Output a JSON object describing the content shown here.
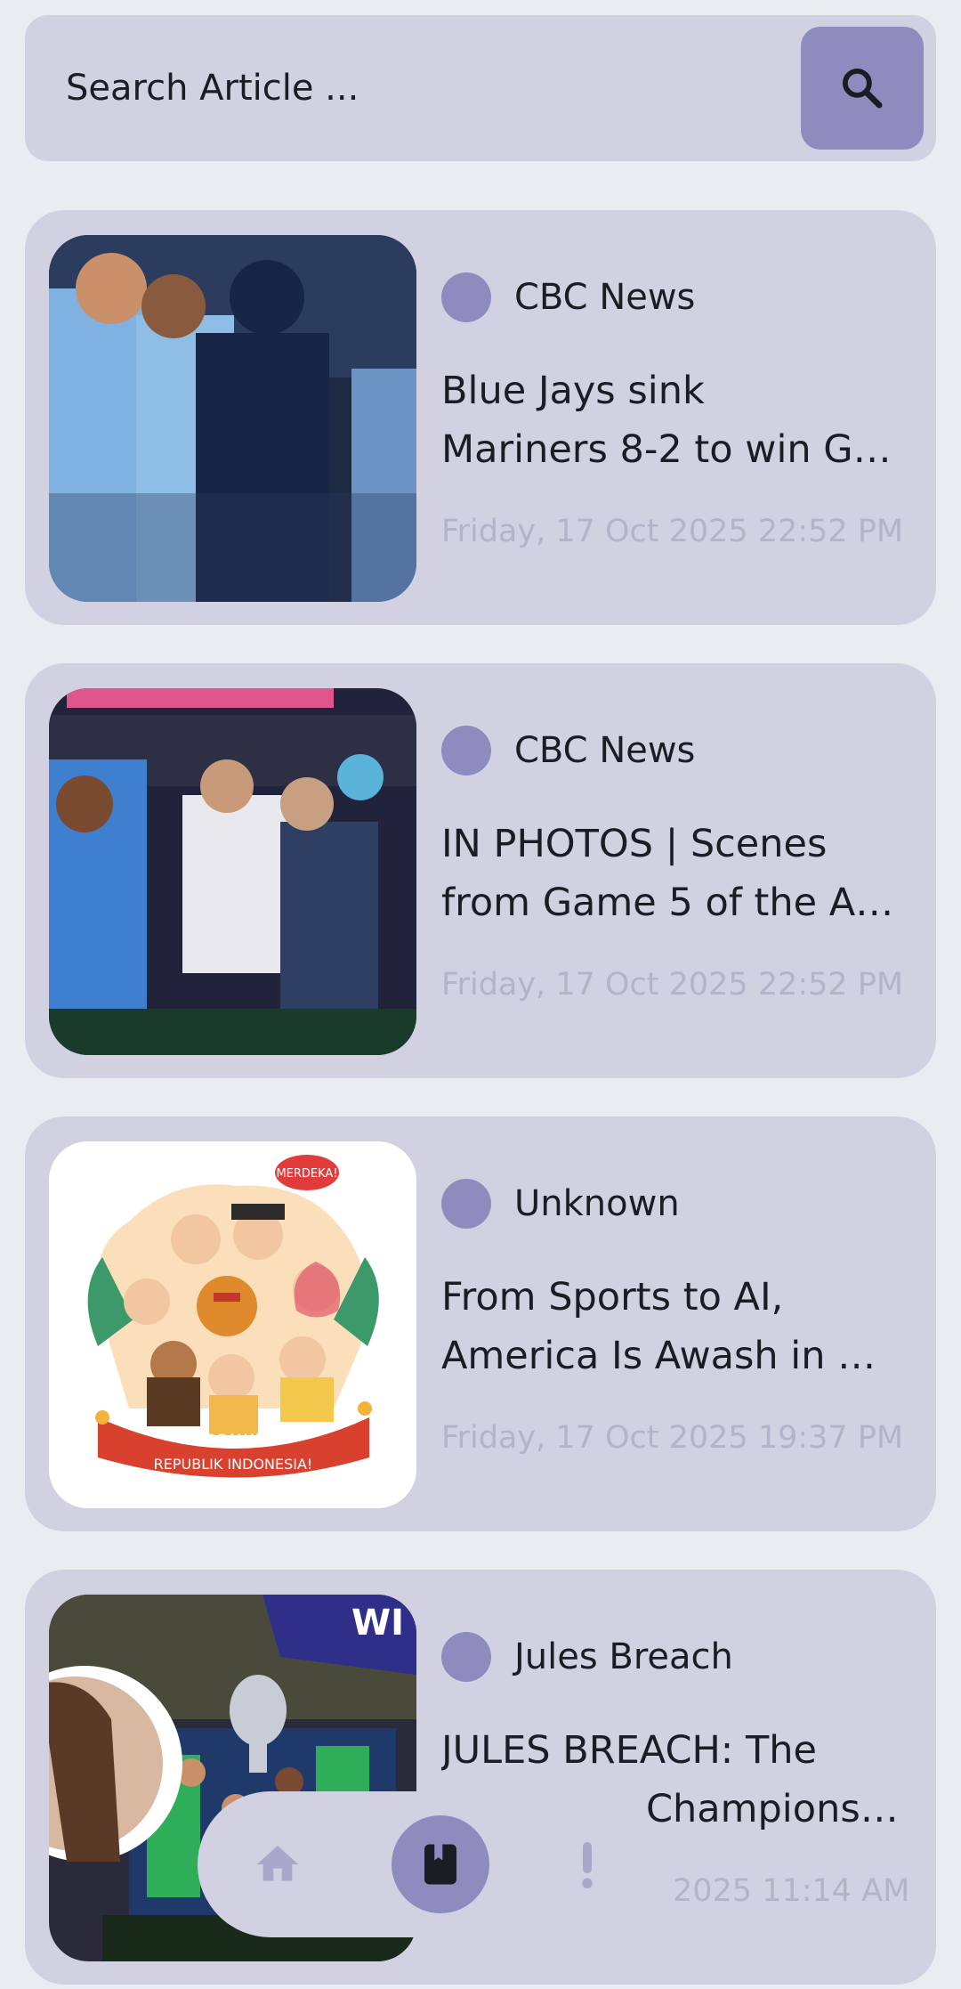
{
  "search": {
    "placeholder": "Search Article ...",
    "icon": "search-icon"
  },
  "articles": [
    {
      "source": "CBC News",
      "title_line1": "Blue Jays sink",
      "title_line2": "Mariners 8-2 to win G…",
      "date": "Friday, 17 Oct 2025 22:52 PM",
      "image": "baseball-players-photo"
    },
    {
      "source": "CBC News",
      "title_line1": "IN PHOTOS | Scenes",
      "title_line2": "from Game 5 of the A…",
      "date": "Friday, 17 Oct 2025 22:52 PM",
      "image": "fans-at-netting-photo"
    },
    {
      "source": "Unknown",
      "title_line1": "From Sports to AI,",
      "title_line2": "America Is Awash in …",
      "date": "Friday, 17 Oct 2025 19:37 PM",
      "image": "illustration",
      "image_texts": [
        "MERDEKA!",
        "DIRGAHAYU",
        "REPUBLIK INDONESIA!"
      ]
    },
    {
      "source": "Jules Breach",
      "title_line1": "JULES BREACH: The",
      "title_line2": "Champions…",
      "date": "2025 11:14 AM",
      "image": "champions-celebration-photo"
    }
  ],
  "bottom_nav": {
    "items": [
      "home-icon",
      "book-icon",
      "alert-icon"
    ],
    "active": "book-icon"
  },
  "colors": {
    "background": "#ebebf2",
    "card": "#d1d1e2",
    "accent": "#8e8cbf",
    "date_text": "#b3b3c9"
  }
}
